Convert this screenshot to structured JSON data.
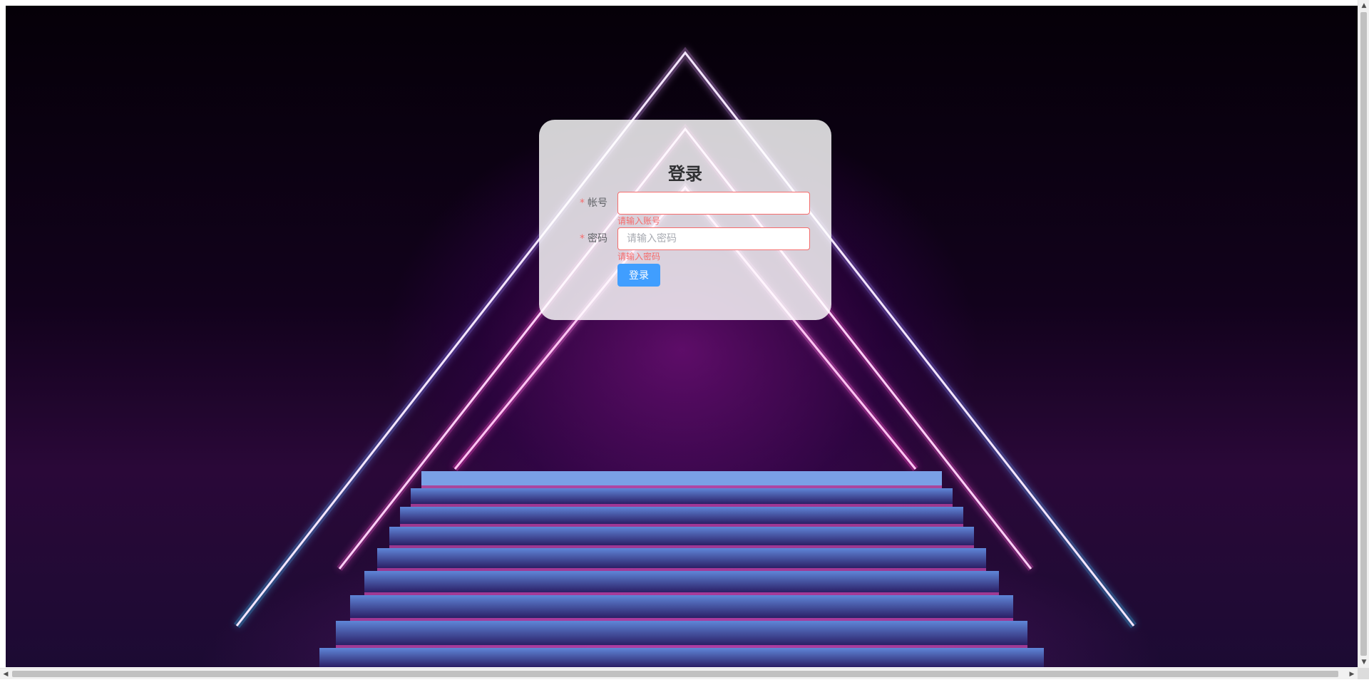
{
  "login": {
    "title": "登录",
    "account": {
      "label": "帐号",
      "required_mark": "*",
      "value": "",
      "placeholder": "",
      "error": "请输入账号"
    },
    "password": {
      "label": "密码",
      "required_mark": "*",
      "value": "",
      "placeholder": "请输入密码",
      "error": "请输入密码"
    },
    "submit_label": "登录"
  },
  "scrollbars": {
    "up_arrow": "▲",
    "down_arrow": "▼",
    "left_arrow": "◀",
    "right_arrow": "▶"
  },
  "colors": {
    "error": "#f56c6c",
    "primary": "#409eff",
    "neon_pink": "#ff4fd8",
    "neon_blue": "#3ec8ff"
  }
}
